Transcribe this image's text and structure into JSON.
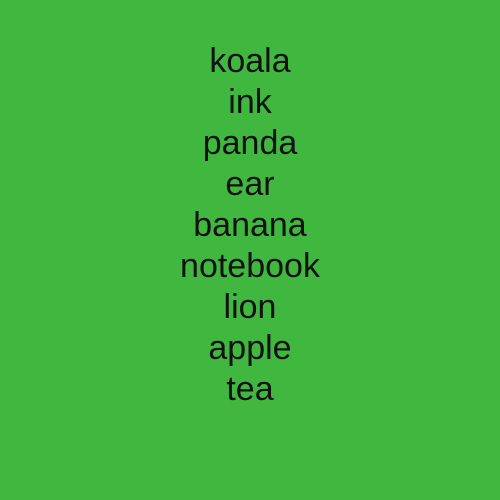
{
  "words": [
    "koala",
    "ink",
    "panda",
    "ear",
    "banana",
    "notebook",
    "lion",
    "apple",
    "tea"
  ],
  "colors": {
    "background": "#40b840",
    "text": "#111111"
  }
}
